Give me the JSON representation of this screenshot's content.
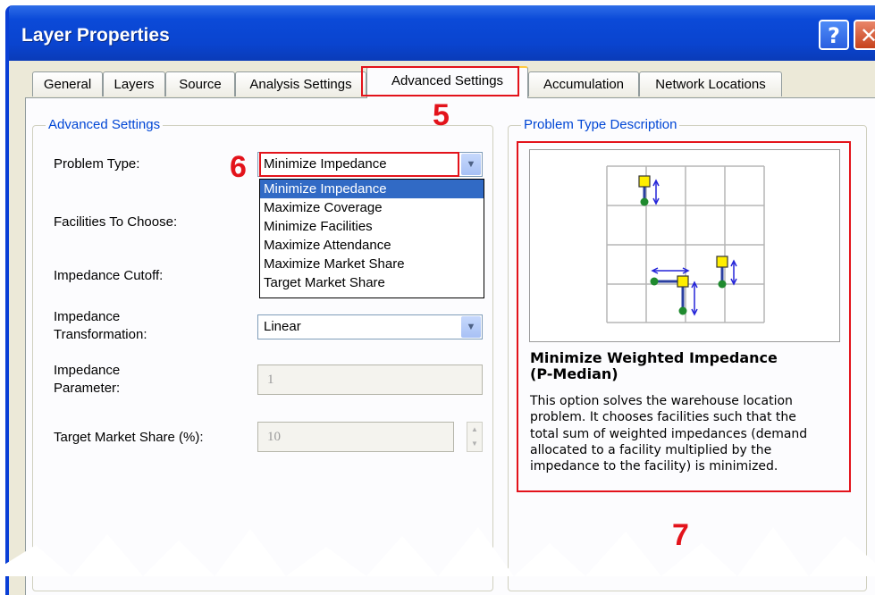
{
  "window": {
    "title": "Layer Properties",
    "help_glyph": "?",
    "close_glyph": "✕"
  },
  "tabs": [
    "General",
    "Layers",
    "Source",
    "Analysis Settings",
    "Advanced Settings",
    "Accumulation",
    "Network Locations"
  ],
  "active_tab": "Advanced Settings",
  "advanced_settings": {
    "group_title": "Advanced Settings",
    "problem_type_label": "Problem Type:",
    "problem_type_value": "Minimize Impedance",
    "facilities_label": "Facilities To Choose:",
    "cutoff_label": "Impedance Cutoff:",
    "transformation_label_line1": "Impedance",
    "transformation_label_line2": "Transformation:",
    "transformation_value": "Linear",
    "parameter_label_line1": "Impedance",
    "parameter_label_line2": "Parameter:",
    "parameter_value": "1",
    "target_share_label": "Target Market Share (%):",
    "target_share_value": "10"
  },
  "problem_type_options": [
    "Minimize Impedance",
    "Maximize Coverage",
    "Minimize Facilities",
    "Maximize Attendance",
    "Maximize Market Share",
    "Target Market Share"
  ],
  "selected_option_index": 0,
  "description": {
    "group_title": "Problem Type Description",
    "title_line1": "Minimize Weighted Impedance",
    "title_line2": "(P-Median)",
    "text_lines": [
      "This option solves the warehouse location",
      "problem. It chooses facilities such that the",
      "total sum of weighted impedances (demand",
      "allocated to a facility multiplied by the",
      "impedance to the facility) is minimized."
    ]
  },
  "annotations": {
    "tab_step": "5",
    "combo_step": "6",
    "description_step": "7"
  },
  "colors": {
    "annotation_red": "#e3131b",
    "title_bar_blue": "#0a44cf",
    "group_title_blue": "#0046d5",
    "selection_blue": "#316ac5",
    "facility_yellow": "#ffee00",
    "demand_green": "#1f8a2e",
    "arrow_blue": "#2424d8"
  }
}
